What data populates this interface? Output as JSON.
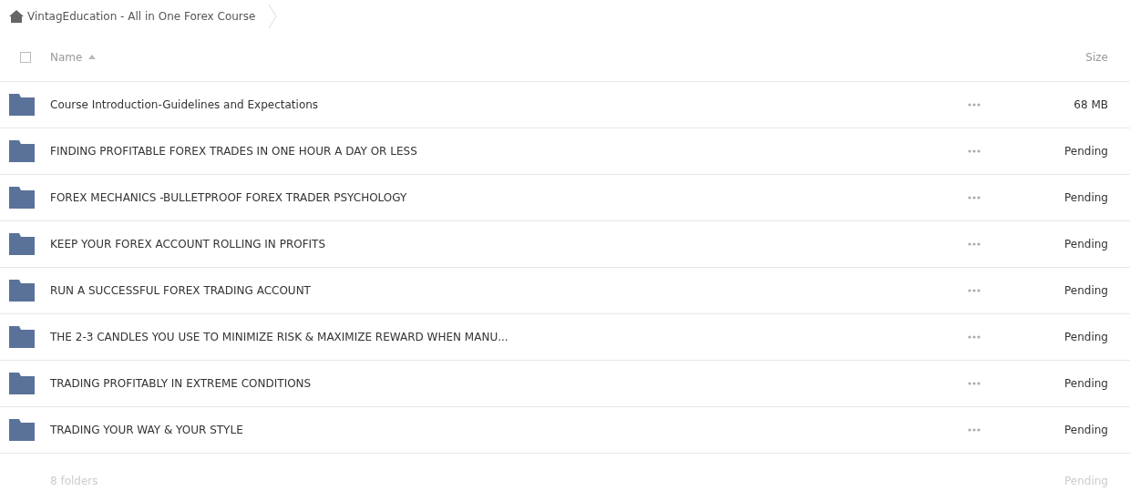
{
  "breadcrumb": {
    "title": "VintagEducation - All in One Forex Course"
  },
  "table": {
    "select_all": {
      "checked": false
    },
    "columns": [
      "Name",
      "Size"
    ],
    "rows": [
      {
        "name": "Course Introduction-Guidelines and Expectations",
        "size": "68 MB"
      },
      {
        "name": "FINDING PROFITABLE FOREX TRADES IN ONE HOUR A DAY OR LESS",
        "size": "Pending"
      },
      {
        "name": "FOREX MECHANICS -BULLETPROOF FOREX TRADER PSYCHOLOGY",
        "size": "Pending"
      },
      {
        "name": "KEEP YOUR FOREX ACCOUNT ROLLING IN PROFITS",
        "size": "Pending"
      },
      {
        "name": "RUN A SUCCESSFUL FOREX TRADING ACCOUNT",
        "size": "Pending"
      },
      {
        "name": "THE 2-3 CANDLES YOU USE TO MINIMIZE RISK & MAXIMIZE REWARD WHEN MANU...",
        "size": "Pending"
      },
      {
        "name": "TRADING PROFITABLY IN EXTREME CONDITIONS",
        "size": "Pending"
      },
      {
        "name": "TRADING YOUR WAY & YOUR STYLE",
        "size": "Pending"
      }
    ]
  },
  "footer": {
    "count": "8 folders",
    "size": "Pending"
  }
}
